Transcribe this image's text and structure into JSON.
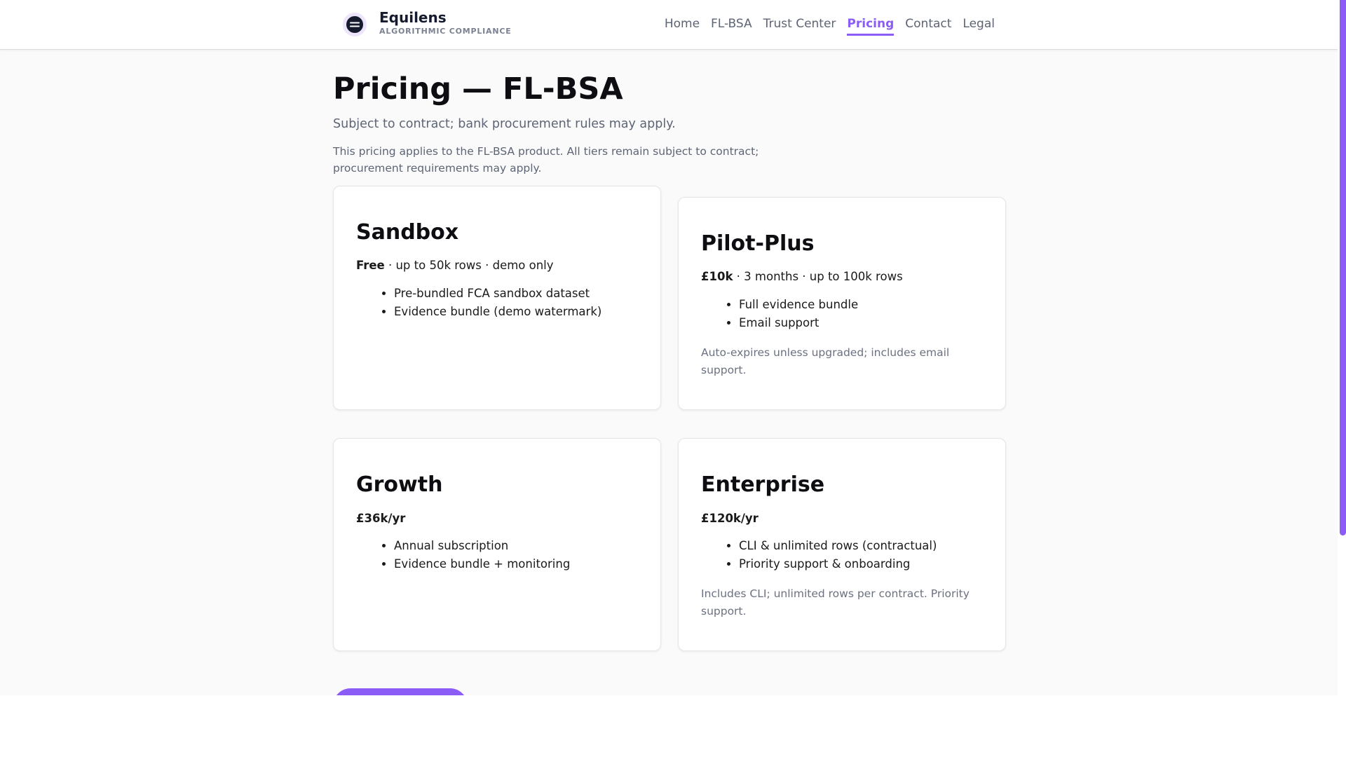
{
  "brand": {
    "name": "Equilens",
    "tagline": "ALGORITHMIC COMPLIANCE",
    "icon": "equilens-logo-icon"
  },
  "nav": [
    {
      "label": "Home",
      "active": false
    },
    {
      "label": "FL-BSA",
      "active": false
    },
    {
      "label": "Trust Center",
      "active": false
    },
    {
      "label": "Pricing",
      "active": true
    },
    {
      "label": "Contact",
      "active": false
    },
    {
      "label": "Legal",
      "active": false
    }
  ],
  "page": {
    "title": "Pricing — FL-BSA",
    "subtitle": "Subject to contract; bank procurement rules may apply.",
    "note_line1": "This pricing applies to the FL-BSA product. All tiers remain subject to contract;",
    "note_line2": "procurement requirements may apply."
  },
  "tiers": [
    {
      "name": "Sandbox",
      "price": "Free",
      "details": " · up to 50k rows · demo only",
      "features": [
        "Pre-bundled FCA sandbox dataset",
        "Evidence bundle (demo watermark)"
      ],
      "note": ""
    },
    {
      "name": "Pilot-Plus",
      "price": "£10k",
      "details": " · 3 months · up to 100k rows",
      "features": [
        "Full evidence bundle",
        "Email support"
      ],
      "note": "Auto-expires unless upgraded; includes email support."
    },
    {
      "name": "Growth",
      "price": "£36k/yr",
      "details": "",
      "features": [
        "Annual subscription",
        "Evidence bundle + monitoring"
      ],
      "note": ""
    },
    {
      "name": "Enterprise",
      "price": "£120k/yr",
      "details": "",
      "features": [
        "CLI & unlimited rows (contractual)",
        "Priority support & onboarding"
      ],
      "note": "Includes CLI; unlimited rows per contract. Priority support."
    }
  ],
  "colors": {
    "accent": "#8b5cf6",
    "text": "#111111",
    "muted": "#5d6474",
    "background": "#fafafb"
  }
}
